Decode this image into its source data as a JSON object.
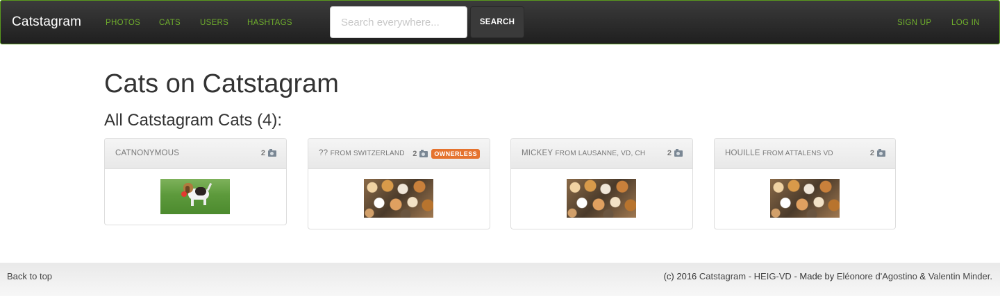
{
  "navbar": {
    "brand": "Catstagram",
    "links": [
      "PHOTOS",
      "CATS",
      "USERS",
      "HASHTAGS"
    ],
    "search_placeholder": "Search everywhere...",
    "search_button": "SEARCH",
    "signup": "SIGN UP",
    "login": "LOG IN"
  },
  "page": {
    "title": "Cats on Catstagram",
    "section_title": "All Catstagram Cats (4):"
  },
  "cats": [
    {
      "name": "CATNONYMOUS",
      "origin": "",
      "photo_count": "2",
      "badge": "",
      "thumbnail": "beagle-puppy-photo"
    },
    {
      "name": "??",
      "origin": "FROM SWITZERLAND",
      "photo_count": "2",
      "badge": "OWNERLESS",
      "thumbnail": "cats-collage-photo"
    },
    {
      "name": "MICKEY",
      "origin": "FROM LAUSANNE, VD, CH",
      "photo_count": "2",
      "badge": "",
      "thumbnail": "cats-collage-photo"
    },
    {
      "name": "HOUILLE",
      "origin": "FROM ATTALENS VD",
      "photo_count": "2",
      "badge": "",
      "thumbnail": "cats-collage-photo"
    }
  ],
  "footer": {
    "back_to_top": "Back to top",
    "copyright_prefix": "(c) 2016 ",
    "site_link": "Catstagram - HEIG-VD",
    "made_by": " - Made by ",
    "author1": "Eléonore d'Agostino",
    "and": " & ",
    "author2": "Valentin Minder",
    "period": "."
  },
  "colors": {
    "nav_link": "#6fae2c",
    "badge": "#e5732f",
    "navbar_border": "#5a9a1e"
  }
}
